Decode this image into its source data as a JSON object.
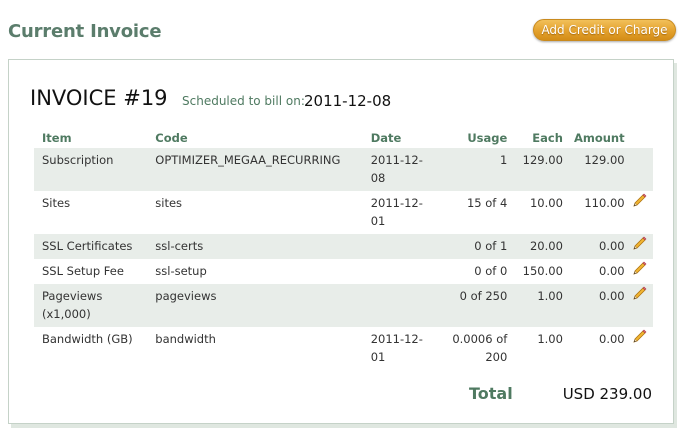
{
  "header": {
    "title": "Current Invoice",
    "add_button": "Add Credit or Charge"
  },
  "invoice": {
    "title": "INVOICE #19",
    "scheduled_label": "Scheduled to bill on:",
    "scheduled_date": "2011-12-08",
    "columns": [
      "Item",
      "Code",
      "Date",
      "Usage",
      "Each",
      "Amount"
    ],
    "rows": [
      {
        "item": "Subscription",
        "code": "OPTIMIZER_MEGAA_RECURRING",
        "date": "2011-12-08",
        "usage": "1",
        "each": "129.00",
        "amount": "129.00",
        "editable": false
      },
      {
        "item": "Sites",
        "code": "sites",
        "date": "2011-12-01",
        "usage": "15 of 4",
        "each": "10.00",
        "amount": "110.00",
        "editable": true
      },
      {
        "item": "SSL Certificates",
        "code": "ssl-certs",
        "date": "",
        "usage": "0 of 1",
        "each": "20.00",
        "amount": "0.00",
        "editable": true
      },
      {
        "item": "SSL Setup Fee",
        "code": "ssl-setup",
        "date": "",
        "usage": "0 of 0",
        "each": "150.00",
        "amount": "0.00",
        "editable": true
      },
      {
        "item": "Pageviews (x1,000)",
        "code": "pageviews",
        "date": "",
        "usage": "0 of 250",
        "each": "1.00",
        "amount": "0.00",
        "editable": true
      },
      {
        "item": "Bandwidth (GB)",
        "code": "bandwidth",
        "date": "2011-12-01",
        "usage": "0.0006 of 200",
        "each": "1.00",
        "amount": "0.00",
        "editable": true
      }
    ],
    "total_label": "Total",
    "total_value": "USD 239.00"
  },
  "icons": {
    "edit": "pencil-icon"
  },
  "colors": {
    "accent_green": "#4f7a61",
    "button_orange": "#e3a12d",
    "row_shade": "#e8ede9"
  }
}
